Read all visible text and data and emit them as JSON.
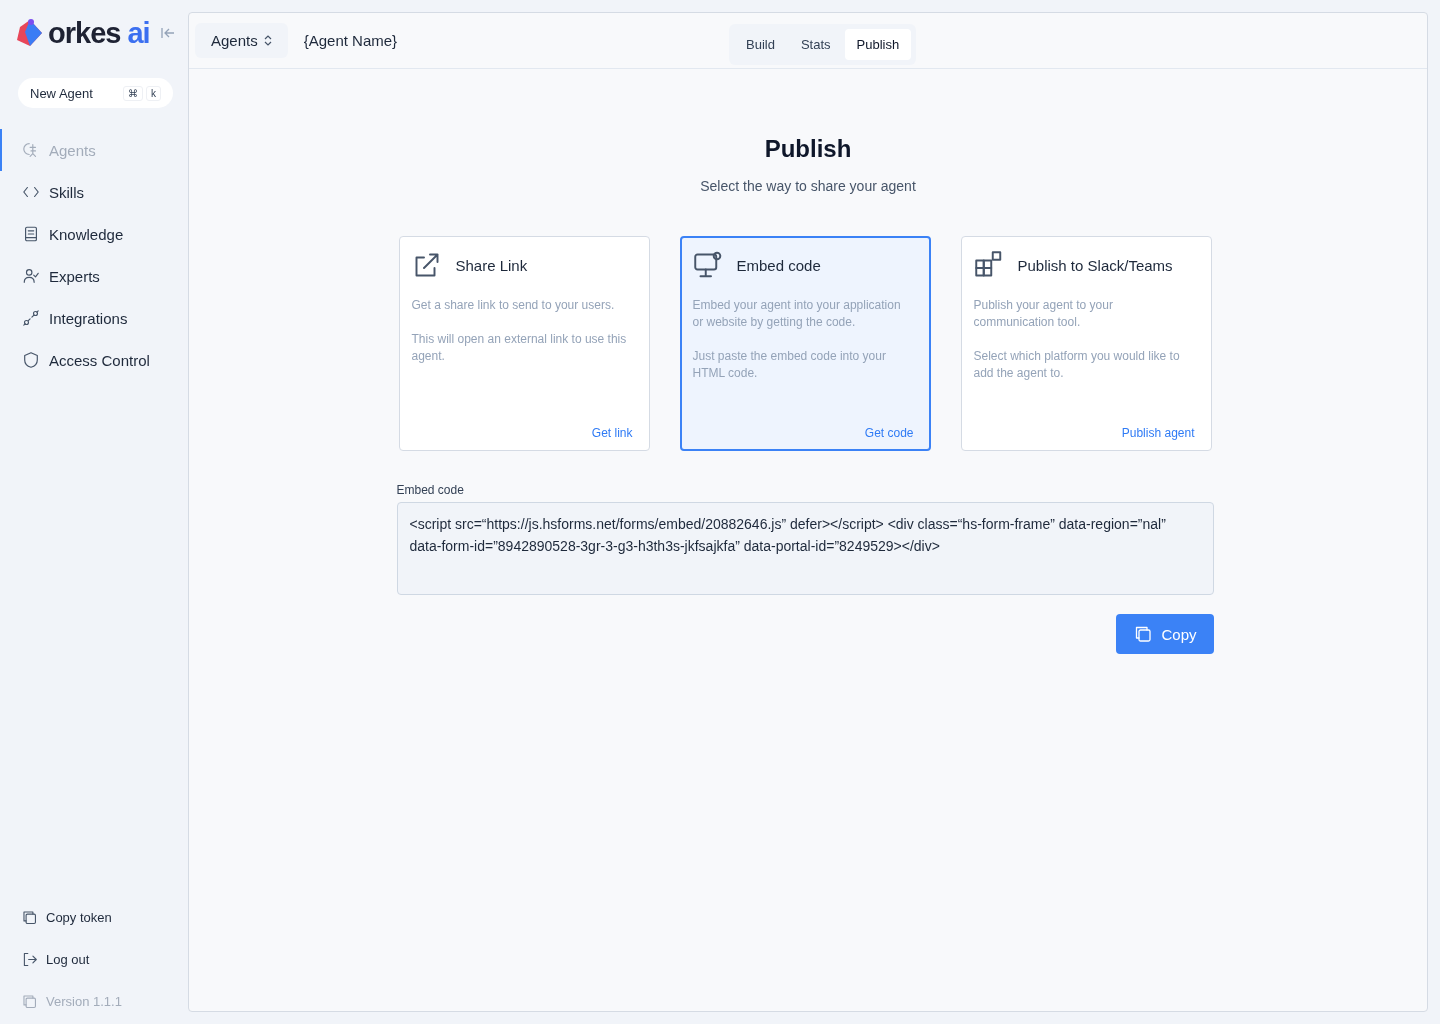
{
  "logo": {
    "word": "orkes",
    "suffix": "ai"
  },
  "new_agent": {
    "label": "New Agent",
    "shortcut": [
      "⌘",
      "k"
    ]
  },
  "sidebar": {
    "items": [
      {
        "label": "Agents",
        "selected": true
      },
      {
        "label": "Skills",
        "selected": false
      },
      {
        "label": "Knowledge",
        "selected": false
      },
      {
        "label": "Experts",
        "selected": false
      },
      {
        "label": "Integrations",
        "selected": false
      },
      {
        "label": "Access Control",
        "selected": false
      }
    ],
    "footer": [
      {
        "label": "Copy token",
        "disabled": false
      },
      {
        "label": "Log out",
        "disabled": false
      },
      {
        "label": "Version 1.1.1",
        "disabled": true
      }
    ]
  },
  "topbar": {
    "breadcrumb": "Agents",
    "agent_name": "{Agent Name}",
    "tabs": [
      {
        "label": "Build",
        "selected": false
      },
      {
        "label": "Stats",
        "selected": false
      },
      {
        "label": "Publish",
        "selected": true
      }
    ]
  },
  "page": {
    "title": "Publish",
    "subtitle": "Select the way to share your agent"
  },
  "options": [
    {
      "title": "Share Link",
      "paragraphs": [
        "Get a share link to send to your users.",
        "This will open an external link to use this agent."
      ],
      "action": "Get link",
      "selected": false
    },
    {
      "title": "Embed code",
      "paragraphs": [
        "Embed your agent into your application or website by getting the code.",
        "Just paste the embed code into your HTML code."
      ],
      "action": "Get code",
      "selected": true
    },
    {
      "title": "Publish to Slack/Teams",
      "paragraphs": [
        "Publish your agent to your communication tool.",
        "Select which platform you would like to add the agent to."
      ],
      "action": "Publish agent",
      "selected": false
    }
  ],
  "embed": {
    "label": "Embed code",
    "value": "<script src=“https://js.hsforms.net/forms/embed/20882646.js” defer></script> <div class=“hs-form-frame” data-region=”nal” data-form-id=”8942890528-3gr-3-g3-h3th3s-jkfsajkfa” data-portal-id=”8249529></div>",
    "button": "Copy"
  }
}
